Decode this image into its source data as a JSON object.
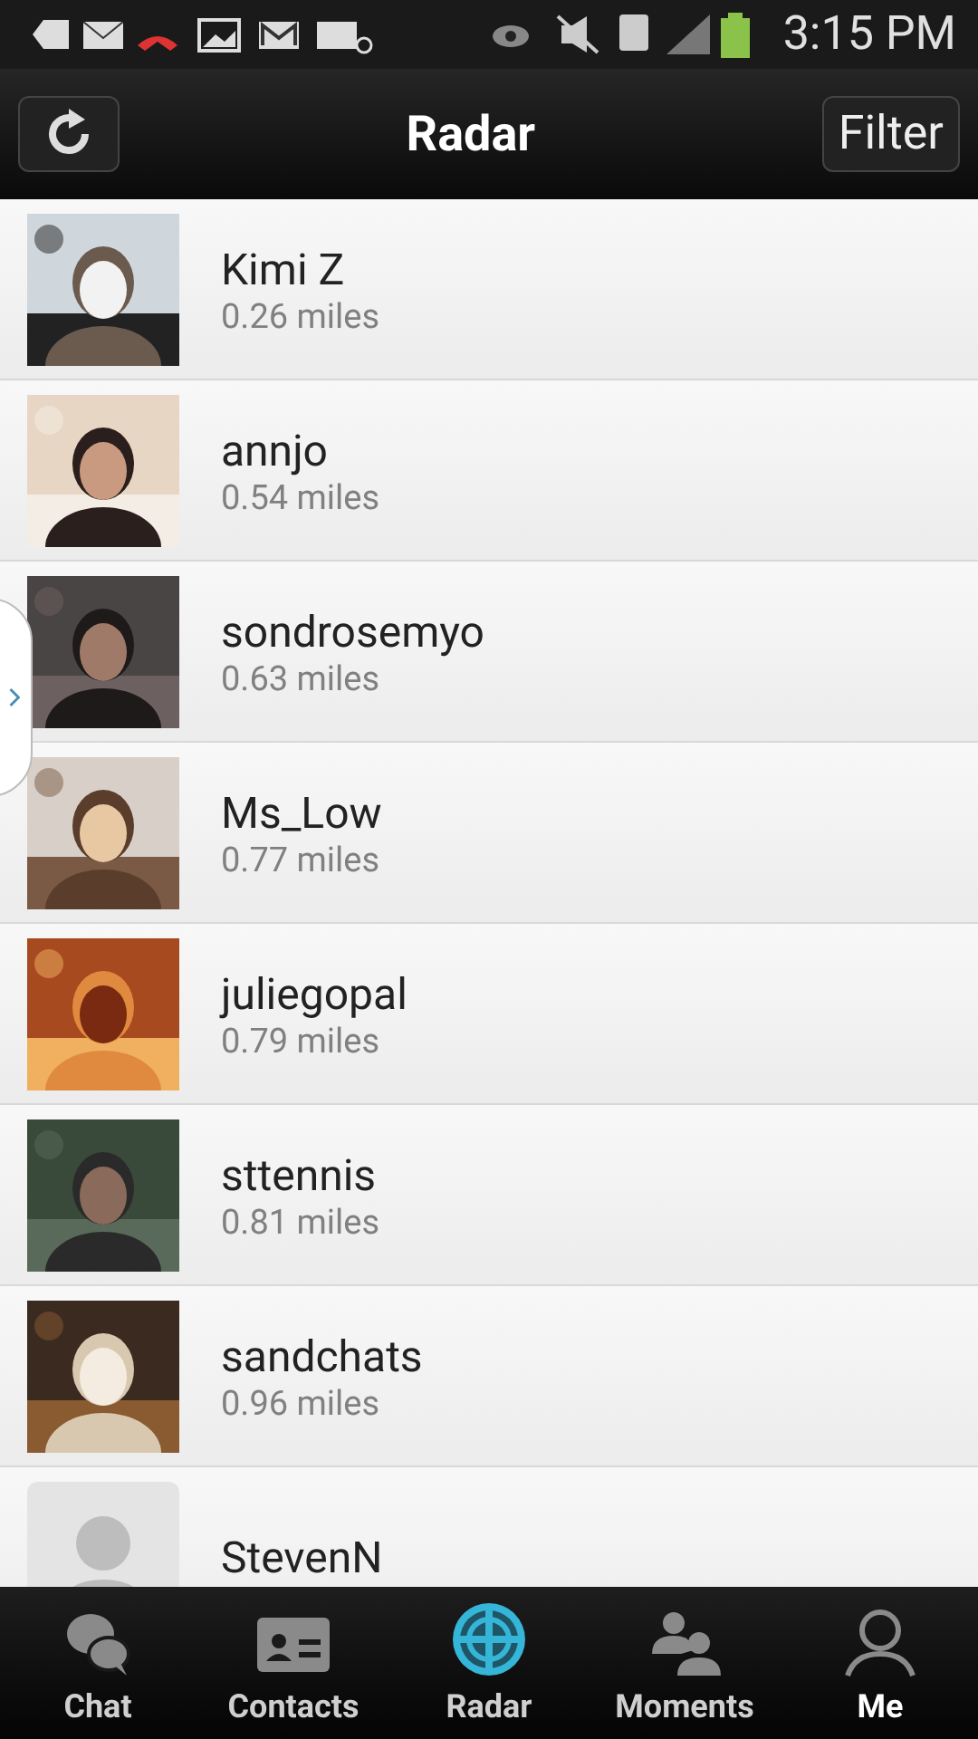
{
  "status_bar": {
    "time": "3:15 PM"
  },
  "header": {
    "title": "Radar",
    "filter_button": "Filter"
  },
  "people": [
    {
      "kind": "picture",
      "name": "Kimi Z",
      "distance": "0.26 miles"
    },
    {
      "kind": "picture",
      "name": "annjo",
      "distance": "0.54 miles"
    },
    {
      "kind": "picture",
      "name": "sondrosemyo",
      "distance": "0.63 miles"
    },
    {
      "kind": "picture",
      "name": "Ms_Low",
      "distance": "0.77 miles"
    },
    {
      "kind": "picture",
      "name": "juliegopal",
      "distance": "0.79 miles"
    },
    {
      "kind": "picture",
      "name": "sttennis",
      "distance": "0.81 miles"
    },
    {
      "kind": "picture",
      "name": "sandchats",
      "distance": "0.96 miles"
    },
    {
      "kind": "default",
      "name": "StevenN"
    }
  ],
  "tabs": [
    {
      "label": "Chat",
      "selected": false,
      "bright": false
    },
    {
      "label": "Contacts",
      "selected": false,
      "bright": false
    },
    {
      "label": "Radar",
      "selected": true,
      "bright": false
    },
    {
      "label": "Moments",
      "selected": false,
      "bright": false
    },
    {
      "label": "Me",
      "selected": false,
      "bright": true
    }
  ]
}
